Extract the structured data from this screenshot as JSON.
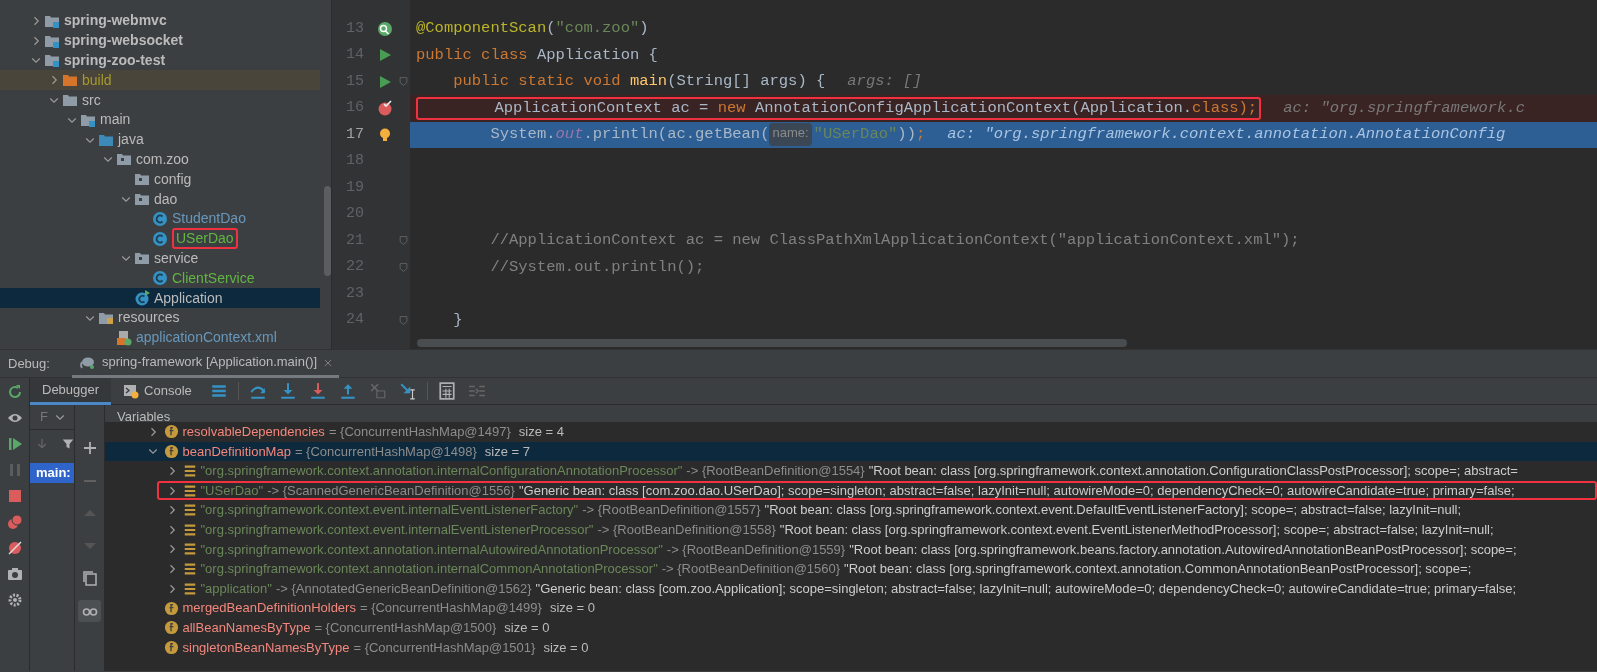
{
  "project_tree": [
    {
      "label": "spring-webmvc",
      "kind": "module",
      "expanded": false,
      "selected": false
    },
    {
      "label": "spring-websocket",
      "kind": "module",
      "expanded": false,
      "selected": false
    },
    {
      "label": "spring-zoo-test",
      "kind": "module",
      "expanded": true,
      "selected": false,
      "children": [
        {
          "label": "build",
          "kind": "excluded-folder",
          "color": "#a49a2c",
          "expanded": false,
          "selected": false
        },
        {
          "label": "src",
          "kind": "folder",
          "expanded": true,
          "selected": false,
          "children": [
            {
              "label": "main",
              "kind": "source-set",
              "expanded": true,
              "selected": false,
              "children": [
                {
                  "label": "java",
                  "kind": "source-root",
                  "expanded": true,
                  "selected": false,
                  "children": [
                    {
                      "label": "com.zoo",
                      "kind": "package",
                      "expanded": true,
                      "selected": false,
                      "children": [
                        {
                          "label": "config",
                          "kind": "package",
                          "selected": false
                        },
                        {
                          "label": "dao",
                          "kind": "package",
                          "expanded": true,
                          "selected": false,
                          "children": [
                            {
                              "label": "StudentDao",
                              "kind": "class",
                              "color": "#6897bb",
                              "selected": false
                            },
                            {
                              "label": "USerDao",
                              "kind": "class",
                              "color": "#62b543",
                              "selected": false,
                              "outlined": true
                            }
                          ]
                        },
                        {
                          "label": "service",
                          "kind": "package",
                          "expanded": true,
                          "selected": false,
                          "children": [
                            {
                              "label": "ClientService",
                              "kind": "class",
                              "color": "#62b543",
                              "selected": false
                            }
                          ]
                        },
                        {
                          "label": "Application",
                          "kind": "main-class",
                          "selected": true
                        }
                      ]
                    }
                  ]
                },
                {
                  "label": "resources",
                  "kind": "resources",
                  "expanded": true,
                  "selected": false,
                  "children": [
                    {
                      "label": "applicationContext.xml",
                      "kind": "xml",
                      "color": "#6897bb",
                      "selected": false
                    }
                  ]
                }
              ]
            }
          ]
        }
      ]
    }
  ],
  "editor": {
    "lines": [
      {
        "number": "13",
        "kind": "bean",
        "tokens": [
          {
            "kind": "annotation",
            "text": "@ComponentScan"
          },
          {
            "kind": "plain",
            "text": "("
          },
          {
            "kind": "string",
            "text": "\"com.zoo\""
          },
          {
            "kind": "plain",
            "text": ")"
          }
        ]
      },
      {
        "number": "14",
        "kind": "run",
        "tokens": [
          {
            "kind": "keyword",
            "text": "public class "
          },
          {
            "kind": "plain",
            "text": "Application {"
          }
        ]
      },
      {
        "number": "15",
        "kind": "run",
        "fold": true,
        "tokens": [
          {
            "kind": "keyword",
            "text": "    public static void "
          },
          {
            "kind": "method",
            "text": "main"
          },
          {
            "kind": "plain",
            "text": "(String[] args) {"
          },
          {
            "kind": "inline-value",
            "text": "args: []"
          }
        ]
      },
      {
        "number": "16",
        "kind": "breakpoint",
        "outlined": true,
        "tokens": [
          {
            "kind": "plain",
            "text": "        ApplicationContext ac = "
          },
          {
            "kind": "keyword",
            "text": "new "
          },
          {
            "kind": "plain",
            "text": "AnnotationConfigApplicationContext(Application."
          },
          {
            "kind": "keyword",
            "text": "class"
          },
          {
            "kind": "keyword",
            "text": ");"
          },
          {
            "kind": "inline-value",
            "text": "ac: \"org.springframework.c"
          }
        ]
      },
      {
        "number": "17",
        "kind": "current",
        "tokens": [
          {
            "kind": "plain",
            "text": "        System."
          },
          {
            "kind": "static-field",
            "text": "out"
          },
          {
            "kind": "plain",
            "text": ".println(ac.getBean("
          },
          {
            "kind": "param-hint",
            "text": "name:"
          },
          {
            "kind": "string",
            "text": "\"USerDao\""
          },
          {
            "kind": "plain",
            "text": "))"
          },
          {
            "kind": "keyword",
            "text": ";"
          },
          {
            "kind": "inline-value",
            "text": "ac: \"org.springframework.context.annotation.AnnotationConfig"
          }
        ]
      },
      {
        "number": "18"
      },
      {
        "number": "19"
      },
      {
        "number": "20"
      },
      {
        "number": "21",
        "fold": true,
        "tokens": [
          {
            "kind": "comment",
            "text": "        //ApplicationContext ac = new ClassPathXmlApplicationContext(\"applicationContext.xml\");"
          }
        ]
      },
      {
        "number": "22",
        "fold": true,
        "tokens": [
          {
            "kind": "comment",
            "text": "        //System.out.println();"
          }
        ]
      },
      {
        "number": "23"
      },
      {
        "number": "24",
        "fold": true,
        "tokens": [
          {
            "kind": "plain",
            "text": "    }"
          }
        ]
      }
    ]
  },
  "debug": {
    "title": "Debug:",
    "session_tab": "spring-framework [Application.main()]",
    "tabs": [
      {
        "label": "Debugger",
        "selected": true
      },
      {
        "label": "Console",
        "selected": false
      }
    ],
    "frames_header": "F",
    "threads": [
      {
        "label": "main:",
        "selected": true
      }
    ],
    "variables_title": "Variables",
    "variables": [
      {
        "kind": "field",
        "name": "resolvableDependencies",
        "ref": "= {ConcurrentHashMap@1497}",
        "size": "size = 4",
        "expanded": false,
        "selected": false
      },
      {
        "kind": "field",
        "name": "beanDefinitionMap",
        "ref": "= {ConcurrentHashMap@1498}",
        "size": "size = 7",
        "expanded": true,
        "selected": true,
        "children": [
          {
            "kind": "entry",
            "name": "\"org.springframework.context.annotation.internalConfigurationAnnotationProcessor\"",
            "ref": "-> {RootBeanDefinition@1554}",
            "description": "\"Root bean: class [org.springframework.context.annotation.ConfigurationClassPostProcessor]; scope=; abstract=",
            "expanded": false,
            "selected": false
          },
          {
            "kind": "entry",
            "name": "\"USerDao\"",
            "ref": "-> {ScannedGenericBeanDefinition@1556}",
            "description": "\"Generic bean: class [com.zoo.dao.USerDao]; scope=singleton; abstract=false; lazyInit=null; autowireMode=0; dependencyCheck=0; autowireCandidate=true; primary=false;",
            "expanded": false,
            "selected": false,
            "outlined": true
          },
          {
            "kind": "entry",
            "name": "\"org.springframework.context.event.internalEventListenerFactory\"",
            "ref": "-> {RootBeanDefinition@1557}",
            "description": "\"Root bean: class [org.springframework.context.event.DefaultEventListenerFactory]; scope=; abstract=false; lazyInit=null;",
            "expanded": false,
            "selected": false
          },
          {
            "kind": "entry",
            "name": "\"org.springframework.context.event.internalEventListenerProcessor\"",
            "ref": "-> {RootBeanDefinition@1558}",
            "description": "\"Root bean: class [org.springframework.context.event.EventListenerMethodProcessor]; scope=; abstract=false; lazyInit=null;",
            "expanded": false,
            "selected": false
          },
          {
            "kind": "entry",
            "name": "\"org.springframework.context.annotation.internalAutowiredAnnotationProcessor\"",
            "ref": "-> {RootBeanDefinition@1559}",
            "description": "\"Root bean: class [org.springframework.beans.factory.annotation.AutowiredAnnotationBeanPostProcessor]; scope=;",
            "expanded": false,
            "selected": false
          },
          {
            "kind": "entry",
            "name": "\"org.springframework.context.annotation.internalCommonAnnotationProcessor\"",
            "ref": "-> {RootBeanDefinition@1560}",
            "description": "\"Root bean: class [org.springframework.context.annotation.CommonAnnotationBeanPostProcessor]; scope=;",
            "expanded": false,
            "selected": false
          },
          {
            "kind": "entry",
            "name": "\"application\"",
            "ref": "-> {AnnotatedGenericBeanDefinition@1562}",
            "description": "\"Generic bean: class [com.zoo.Application]; scope=singleton; abstract=false; lazyInit=null; autowireMode=0; dependencyCheck=0; autowireCandidate=true; primary=false;",
            "expanded": false,
            "selected": false
          }
        ]
      },
      {
        "kind": "field",
        "name": "mergedBeanDefinitionHolders",
        "ref": "= {ConcurrentHashMap@1499}",
        "size": "size = 0",
        "selected": false
      },
      {
        "kind": "field",
        "name": "allBeanNamesByType",
        "ref": "= {ConcurrentHashMap@1500}",
        "size": "size = 0",
        "selected": false
      },
      {
        "kind": "field",
        "name": "singletonBeanNamesByType",
        "ref": "= {ConcurrentHashMap@1501}",
        "size": "size = 0",
        "selected": false
      }
    ]
  }
}
